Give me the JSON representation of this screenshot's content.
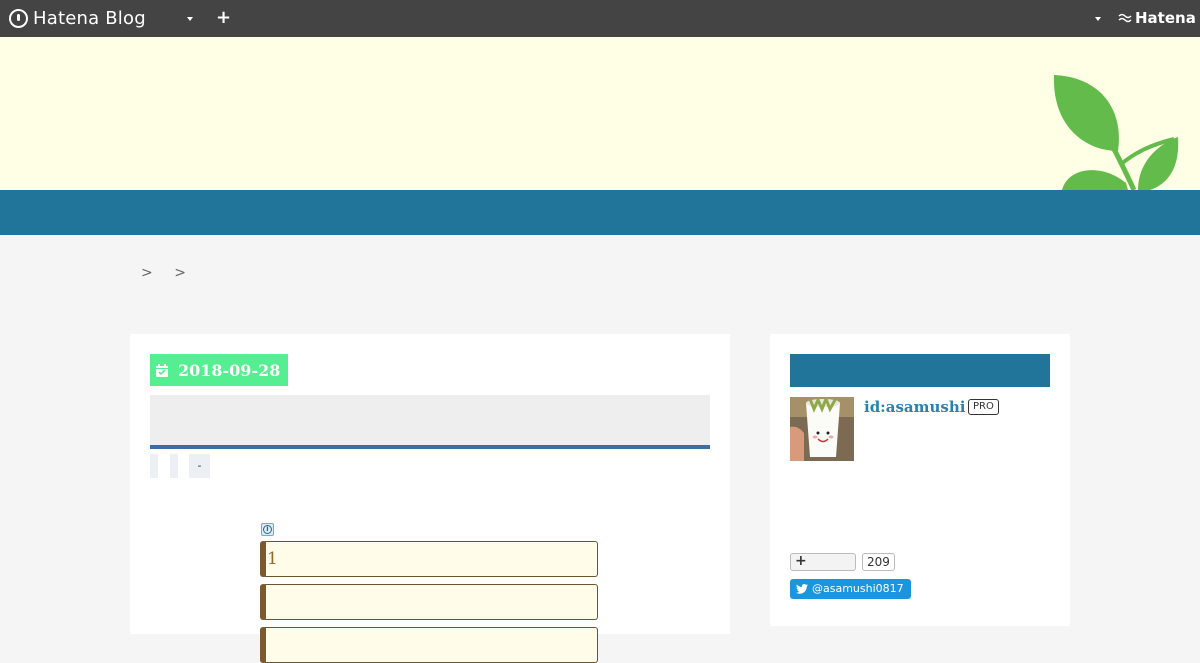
{
  "topbar": {
    "brand": "Hatena Blog",
    "add_button": "+",
    "hatena_logo": "Hatena"
  },
  "breadcrumb": {
    "separators": [
      ">",
      ">"
    ]
  },
  "article": {
    "date": "2018-09-28",
    "tag_3": "-",
    "quiz_answer_1": "1",
    "quiz_answer_2": ""
  },
  "sidebar": {
    "profile_id": "id:asamushi",
    "pro_badge": "PRO",
    "subscriber_count": "209",
    "twitter_handle": "@asamushi0817"
  },
  "colors": {
    "topbar": "#444444",
    "header_bg": "#ffffe5",
    "nav_blue": "#21759b",
    "date_green": "#55ee90",
    "leaf_green": "#62bb4b",
    "twitter_blue": "#1b95e0"
  },
  "icons": [
    "hatena-blog-logo-icon",
    "caret-down-icon",
    "plus-icon",
    "hatena-logo-icon",
    "calendar-check-icon",
    "info-icon",
    "twitter-bird-icon"
  ]
}
